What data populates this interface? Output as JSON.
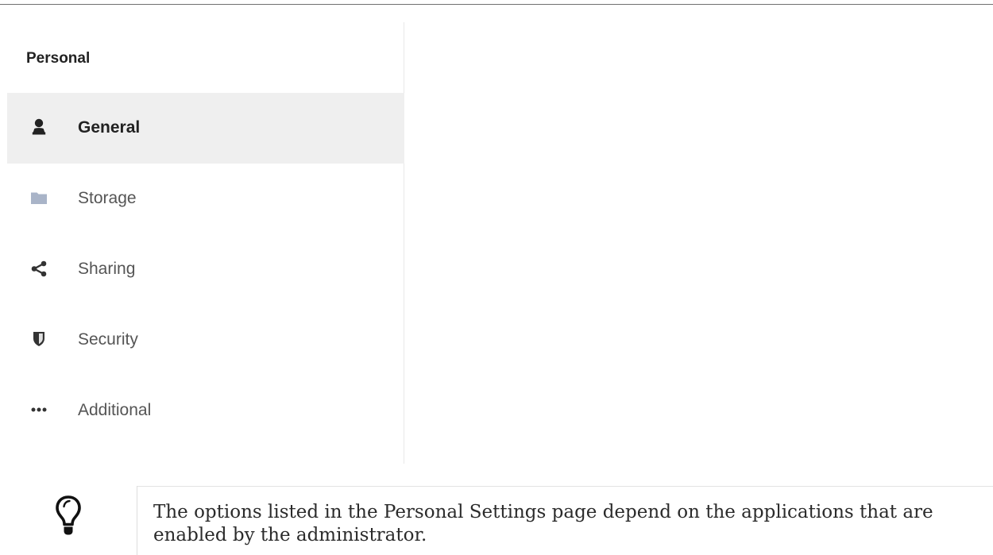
{
  "sidebar": {
    "section_title": "Personal",
    "items": [
      {
        "label": "General",
        "icon": "user-icon",
        "active": true
      },
      {
        "label": "Storage",
        "icon": "folder-icon",
        "active": false
      },
      {
        "label": "Sharing",
        "icon": "share-icon",
        "active": false
      },
      {
        "label": "Security",
        "icon": "shield-icon",
        "active": false
      },
      {
        "label": "Additional",
        "icon": "more-horizontal-icon",
        "active": false
      }
    ]
  },
  "tip": {
    "icon": "lightbulb-icon",
    "text": "The options listed in the Personal Settings page depend on the applications that are enabled by the administrator."
  },
  "colors": {
    "active_background": "#efefef",
    "folder_icon": "#a9b4c8",
    "icon_dark": "#222222",
    "inactive_label": "#555555"
  }
}
